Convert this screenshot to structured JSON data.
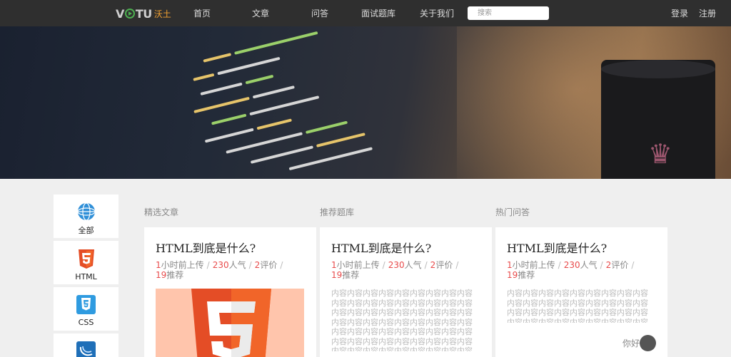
{
  "logo": {
    "en": "VOTU",
    "cn": "沃土"
  },
  "nav": {
    "items": [
      "首页",
      "文章",
      "问答",
      "面试题库",
      "关于我们"
    ],
    "search_placeholder": "搜索",
    "login": "登录",
    "register": "注册"
  },
  "sidebar": {
    "items": [
      {
        "label": "全部",
        "icon": "globe-icon"
      },
      {
        "label": "HTML",
        "icon": "html5-icon"
      },
      {
        "label": "CSS",
        "icon": "css3-icon"
      },
      {
        "label": "",
        "icon": "jquery-icon"
      }
    ]
  },
  "sections": {
    "articles": "精选文章",
    "questions": "推荐题库",
    "qa": "热门问答"
  },
  "cards": [
    {
      "title": "HTML到底是什么?",
      "time_num": "1",
      "time_text": "小时前上传",
      "pop_num": "230",
      "pop_text": "人气",
      "review_num": "2",
      "review_text": "评价",
      "rec_num": "19",
      "rec_text": "推荐",
      "image": "html5-logo"
    },
    {
      "title": "HTML到底是什么?",
      "time_num": "1",
      "time_text": "小时前上传",
      "pop_num": "230",
      "pop_text": "人气",
      "review_num": "2",
      "review_text": "评价",
      "rec_num": "19",
      "rec_text": "推荐",
      "body": "内容内容内容内容内容内容内容内容内容内容内容内容内容内容内容内容内容内容内容内容内容内容内容内容内容内容内容内容内容内容内容内容内容内容内容内容内容内容内容内容内容内容内容内容内容内容内容内容内容内容内容内容内容内容内容内容内容内容内容内容内容内容内容内容内容内容内容内容…内容内容内容内容内容内容内容内容内容内容内容内容"
    },
    {
      "title": "HTML到底是什么?",
      "time_num": "1",
      "time_text": "小时前上传",
      "pop_num": "230",
      "pop_text": "人气",
      "review_num": "2",
      "review_text": "评价",
      "rec_num": "19",
      "rec_text": "推荐",
      "body": "内容内容内容内容内容内容内容内容内容内容内容内容内容内容内容内容内容内容内容内容内容内容内容内容内容内容内容内容内容内容内容内容内容内容内容内容内容内容内容内容内容内容内容内容内容…内容内容内容内容内容内容内容内容内容内容"
    }
  ],
  "chat": {
    "label": "你好"
  },
  "colors": {
    "navbar": "#2f2f2f",
    "accent_red": "#e84b4b",
    "html5_orange": "#e44d26",
    "css3_blue": "#1572b6"
  }
}
